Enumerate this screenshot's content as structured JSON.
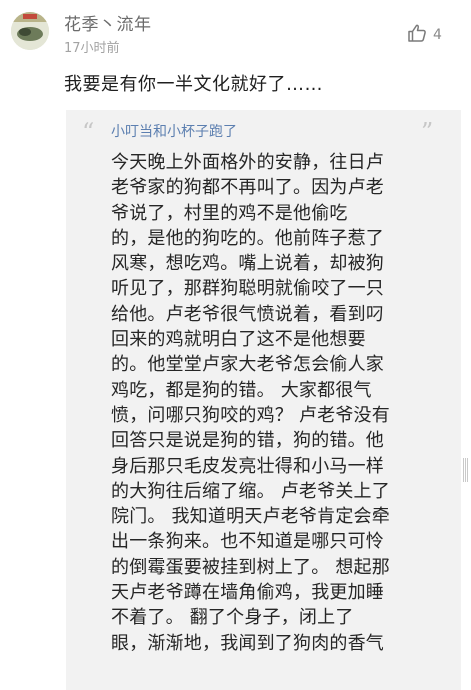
{
  "comment": {
    "author": "花季丶流年",
    "time": "17小时前",
    "likes": "4",
    "text": "我要是有你一半文化就好了……",
    "icons": {
      "avatar": "avatar-image",
      "like": "thumbs-up-icon"
    }
  },
  "quote": {
    "author": "小叮当和小杯子跑了",
    "open_mark": "“",
    "close_mark": "”",
    "lines": [
      "今天晚上外面格外的安静，往日卢",
      "老爷家的狗都不再叫了。因为卢老",
      "爷说了，村里的鸡不是他偷吃",
      "的，是他的狗吃的。他前阵子惹了",
      "风寒，想吃鸡。嘴上说着，却被狗",
      "听见了，那群狗聪明就偷咬了一只",
      "给他。卢老爷很气愤说着，看到叼",
      "回来的鸡就明白了这不是他想要",
      "的。他堂堂卢家大老爷怎会偷人家",
      "鸡吃，都是狗的错。 大家都很气",
      "愤，问哪只狗咬的鸡？ 卢老爷没有",
      "回答只是说是狗的错，狗的错。他",
      "身后那只毛皮发亮壮得和小马一样",
      "的大狗往后缩了缩。 卢老爷关上了",
      "院门。 我知道明天卢老爷肯定会牵",
      "出一条狗来。也不知道是哪只可怜",
      "的倒霉蛋要被挂到树上了。 想起那",
      "天卢老爷蹲在墙角偷鸡，我更加睡",
      "不着了。 翻了个身子，闭上了",
      "眼，渐渐地，我闻到了狗肉的香气"
    ]
  },
  "colors": {
    "background": "#ffffff",
    "quote_background": "#f2f2f2",
    "link": "#5c7fb0",
    "meta": "#a3a3a3"
  }
}
